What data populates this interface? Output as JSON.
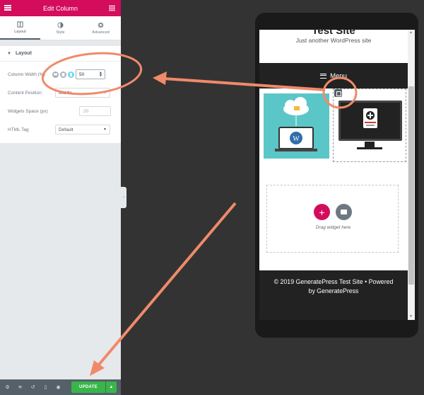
{
  "panel": {
    "title": "Edit Column",
    "tabs": [
      {
        "label": "Layout",
        "icon": "columns-icon"
      },
      {
        "label": "Style",
        "icon": "half-circle-icon"
      },
      {
        "label": "Advanced",
        "icon": "gear-icon"
      }
    ],
    "section_title": "Layout",
    "column_width": {
      "label": "Column Width (%)",
      "value": "50"
    },
    "content_position": {
      "label": "Content Position",
      "value": "Middle"
    },
    "widgets_space": {
      "label": "Widgets Space (px)",
      "placeholder": "20"
    },
    "html_tag": {
      "label": "HTML Tag",
      "value": "Default"
    },
    "update_label": "UPDATE"
  },
  "preview": {
    "site_title": "Test Site",
    "tagline": "Just another WordPress site",
    "menu_label": "Menu",
    "dropzone_text": "Drag widget here",
    "footer_line1": "© 2019 GeneratePress Test Site • Powered",
    "footer_line2": "by GeneratePress"
  },
  "colors": {
    "brand": "#d30c5c",
    "update": "#39b54a",
    "annotation": "#f08a6a"
  }
}
